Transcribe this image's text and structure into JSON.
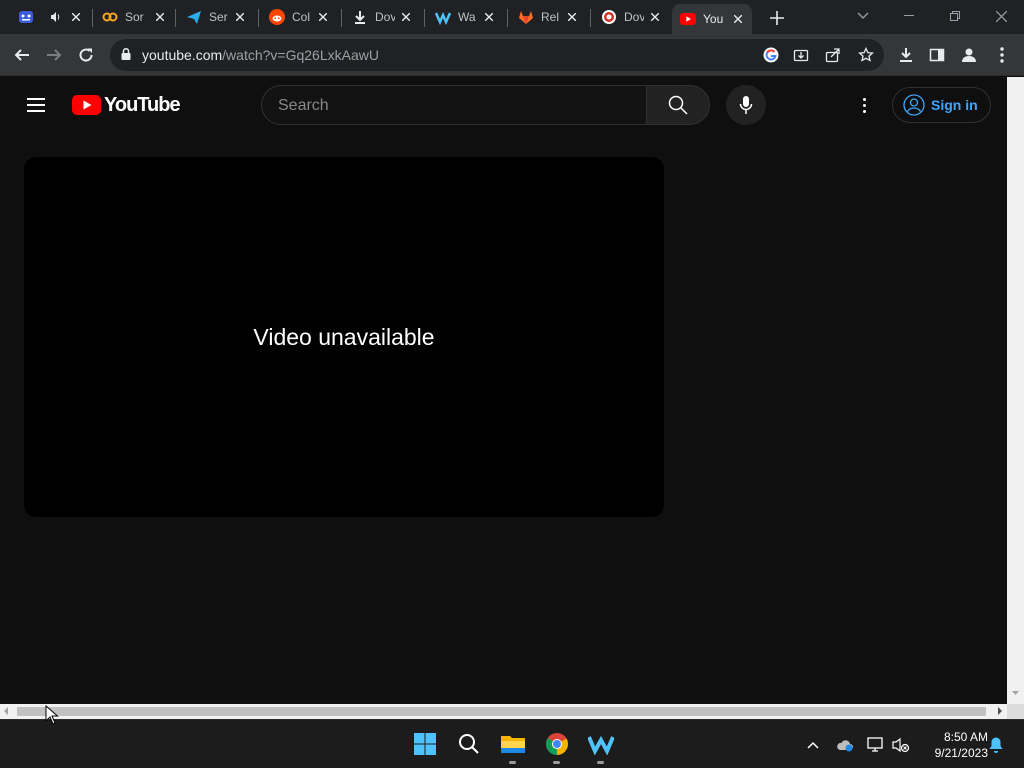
{
  "browser": {
    "tabs": [
      {
        "title": "",
        "favicon": "game-favicon",
        "audio": true
      },
      {
        "title": "Sor",
        "favicon": "infinity-favicon"
      },
      {
        "title": "Ser",
        "favicon": "telegram-favicon"
      },
      {
        "title": "Col",
        "favicon": "reddit-favicon"
      },
      {
        "title": "Dov",
        "favicon": "download-favicon"
      },
      {
        "title": "Wa",
        "favicon": "wave-favicon"
      },
      {
        "title": "Rel",
        "favicon": "gitlab-favicon"
      },
      {
        "title": "Dov",
        "favicon": "circle-favicon"
      },
      {
        "title": "You",
        "favicon": "youtube-favicon",
        "active": true
      }
    ],
    "url_host": "youtube.com",
    "url_path": "/watch?v=Gq26LxkAawU"
  },
  "youtube": {
    "logo_text": "YouTube",
    "search_placeholder": "Search",
    "sign_in_label": "Sign in",
    "player_message": "Video unavailable"
  },
  "taskbar": {
    "time": "8:50 AM",
    "date": "9/21/2023"
  },
  "colors": {
    "youtube_red": "#ff0000",
    "link_blue": "#3ea6ff",
    "page_bg": "#0f0f0f"
  }
}
